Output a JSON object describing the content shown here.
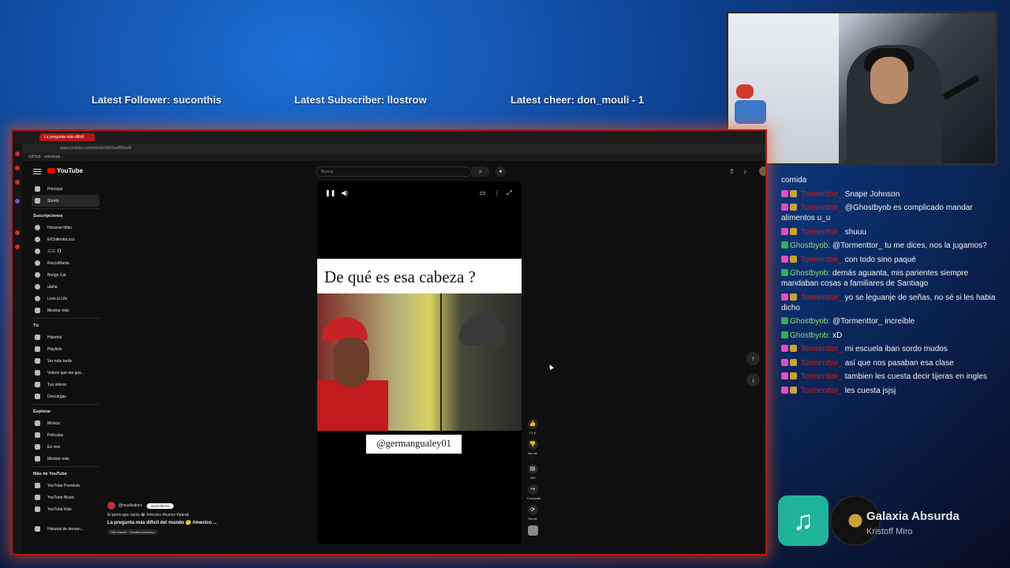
{
  "overlay": {
    "latest_follower": "Latest Follower: suconthis",
    "latest_subscriber": "Latest Subscriber: llostrow",
    "latest_cheer": "Latest cheer: don_mouli - 1"
  },
  "chat": {
    "lines": [
      {
        "user": "",
        "message": "comida",
        "badge": ""
      },
      {
        "user": "Tormenttor_",
        "message": "Snape Johnson",
        "badge": "sub"
      },
      {
        "user": "Tormenttor_",
        "message": "@Ghostbyob es complicado mandar alimentos u_u",
        "badge": "sub"
      },
      {
        "user": "Tormenttor_",
        "message": "shuuu",
        "badge": "sub"
      },
      {
        "user": "Ghostbyob:",
        "message": "@Tormenttor_ tu me dices, nos la jugamos?",
        "badge": "mod"
      },
      {
        "user": "Tormenttor_",
        "message": "con todo sino paqué",
        "badge": "sub"
      },
      {
        "user": "Ghostbyob:",
        "message": "demás aguanta, mis parientes siempre mandaban cosas a familiares de Santiago",
        "badge": "mod"
      },
      {
        "user": "Tormenttor_",
        "message": "yo se leguanje de señas, no sé si les habia dicho",
        "badge": "sub"
      },
      {
        "user": "Ghostbyob:",
        "message": "@Tormenttor_ increíble",
        "badge": "mod"
      },
      {
        "user": "Ghostbyob:",
        "message": "xD",
        "badge": "mod"
      },
      {
        "user": "Tormenttor_",
        "message": "mi escuela iban sordo mudos",
        "badge": "sub"
      },
      {
        "user": "Tormenttor_",
        "message": "así que nos pasaban esa clase",
        "badge": "sub"
      },
      {
        "user": "Tormenttor_",
        "message": "tambien les cuesta decir tijeras en ingles",
        "badge": "sub"
      },
      {
        "user": "Tormenttor_",
        "message": "les cuesta jsjsj",
        "badge": "sub"
      }
    ]
  },
  "now_playing": {
    "title": "Galaxia Absurda",
    "artist": "Kristoff Miro",
    "icon": "music-note-icon"
  },
  "browser": {
    "tab_title": "La pregunta más difícil",
    "url": "www.youtube.com/shorts/VMGeeBB6oM",
    "bookmark": "GitHub - wiredopp..."
  },
  "youtube": {
    "logo": "YouTube",
    "search_placeholder": "Buscar",
    "sidebar": {
      "main": [
        "Principal",
        "Shorts"
      ],
      "subs_header": "Suscripciones",
      "subs": [
        "Horacne Miku",
        "ElChillentoLoco",
        "三三【】",
        "RuccoMania",
        "Bongo Cat",
        "utaha",
        "Love is Life",
        "Mostrar más"
      ],
      "you_header": "Tú",
      "you": [
        "Historial",
        "Playlists",
        "Ver más tarde",
        "Videos que me gus...",
        "Tus videos",
        "Descargas"
      ],
      "explore_header": "Explorar",
      "explore": [
        "Música",
        "Películas",
        "En vivo",
        "Mostrar más"
      ],
      "more_header": "Más de YouTube",
      "more": [
        "YouTube Premium",
        "YouTube Music",
        "YouTube Kids"
      ],
      "footer": "Historial de denunc..."
    },
    "short": {
      "caption": "De qué es esa cabeza ?",
      "handle": "@germangualey01",
      "likes": "7.1 K",
      "dislike": "No me ...",
      "comments": "259",
      "share": "Compartir",
      "remix": "Remix"
    },
    "meta": {
      "channel": "@musikalnco",
      "subscribe": "Suscribirme",
      "desc": "El perro que canta 😂 #mexico #humor #parati",
      "title": "La pregunta más difícil del mundo 🤔 #mexico ...",
      "song": "Hier encore · Charles Aznavour"
    }
  }
}
